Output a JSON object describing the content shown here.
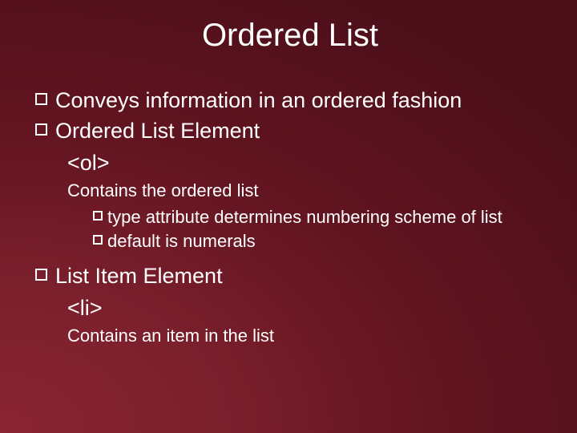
{
  "title": "Ordered List",
  "bullets": {
    "b1": "Conveys information in an ordered fashion",
    "b2": "Ordered List Element",
    "b2_sub1": "<ol>",
    "b2_sub2": "Contains the ordered list",
    "b2_sub3a": "type attribute determines numbering scheme of list",
    "b2_sub3b": "default is numerals",
    "b3": "List Item Element",
    "b3_sub1": "<li>",
    "b3_sub2": "Contains an item in the list"
  }
}
